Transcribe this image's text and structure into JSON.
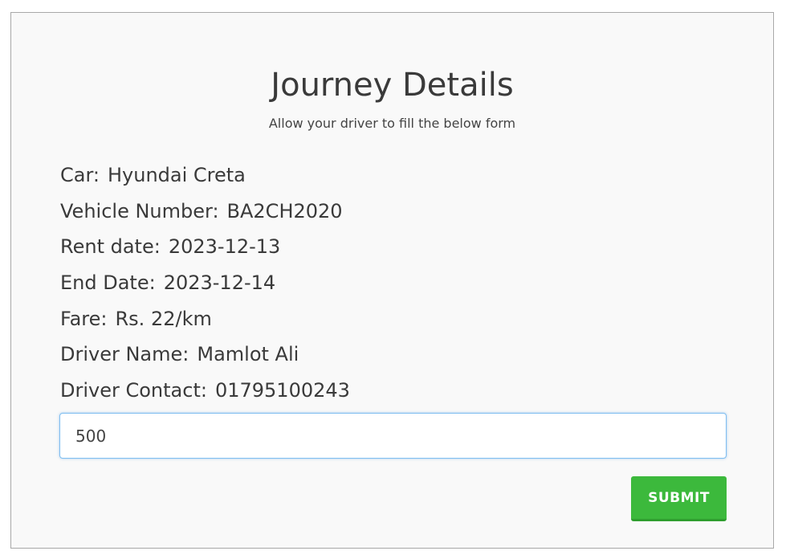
{
  "form": {
    "title": "Journey Details",
    "subtitle": "Allow your driver to fill the below form",
    "fields": [
      {
        "label": "Car:",
        "value": "Hyundai Creta"
      },
      {
        "label": "Vehicle Number:",
        "value": "BA2CH2020"
      },
      {
        "label": "Rent date:",
        "value": "2023-12-13"
      },
      {
        "label": "End Date:",
        "value": "2023-12-14"
      },
      {
        "label": "Fare:",
        "value": "Rs. 22/km"
      },
      {
        "label": "Driver Name:",
        "value": "Mamlot Ali"
      },
      {
        "label": "Driver Contact:",
        "value": "01795100243"
      }
    ],
    "input_value": "500",
    "submit_label": "SUBMIT"
  },
  "colors": {
    "submit": "#3cb93c",
    "input_focus_border": "#7fbef0"
  }
}
